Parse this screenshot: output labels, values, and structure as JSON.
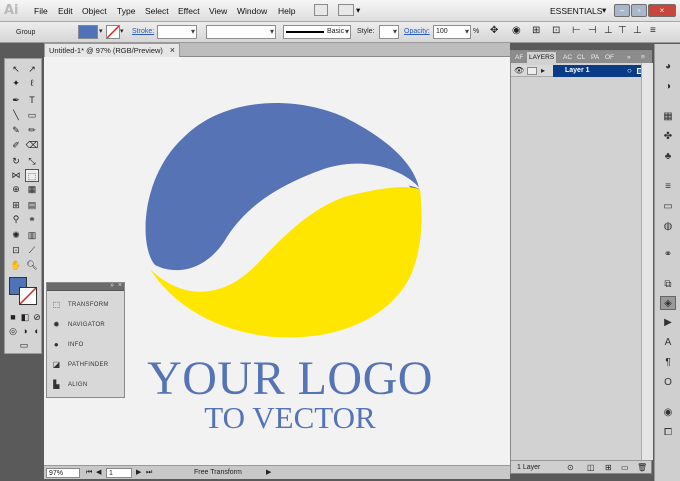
{
  "app": {
    "logo": "Ai"
  },
  "menu": [
    "File",
    "Edit",
    "Object",
    "Type",
    "Select",
    "Effect",
    "View",
    "Window",
    "Help"
  ],
  "workspace": "ESSENTIALS",
  "control": {
    "selection": "Group",
    "stroke_label": "Stroke:",
    "stroke_style": "Basic",
    "style_label": "Style:",
    "opacity_label": "Opacity:",
    "opacity_value": "100",
    "opacity_unit": "%",
    "fill_color": "#4f73b8"
  },
  "document_tab": {
    "title": "Untitled-1* @ 97% (RGB/Preview)",
    "close": "×"
  },
  "artwork": {
    "line1": "YOUR LOGO",
    "line2": "TO VECTOR",
    "blue": "#5573b5",
    "yellow": "#ffe600"
  },
  "floating_panel": {
    "items": [
      {
        "label": "TRANSFORM",
        "icon": "transform-icon"
      },
      {
        "label": "NAVIGATOR",
        "icon": "navigator-icon"
      },
      {
        "label": "INFO",
        "icon": "info-icon"
      },
      {
        "label": "PATHFINDER",
        "icon": "pathfinder-icon"
      },
      {
        "label": "ALIGN",
        "icon": "align-icon"
      }
    ]
  },
  "layers_panel": {
    "tabs": [
      "AF",
      "LAYERS",
      "AC",
      "CL",
      "PA",
      "OF"
    ],
    "layer_name": "Layer 1",
    "footer": "1 Layer"
  },
  "status": {
    "zoom": "97%",
    "page": "1",
    "tool": "Free Transform"
  }
}
